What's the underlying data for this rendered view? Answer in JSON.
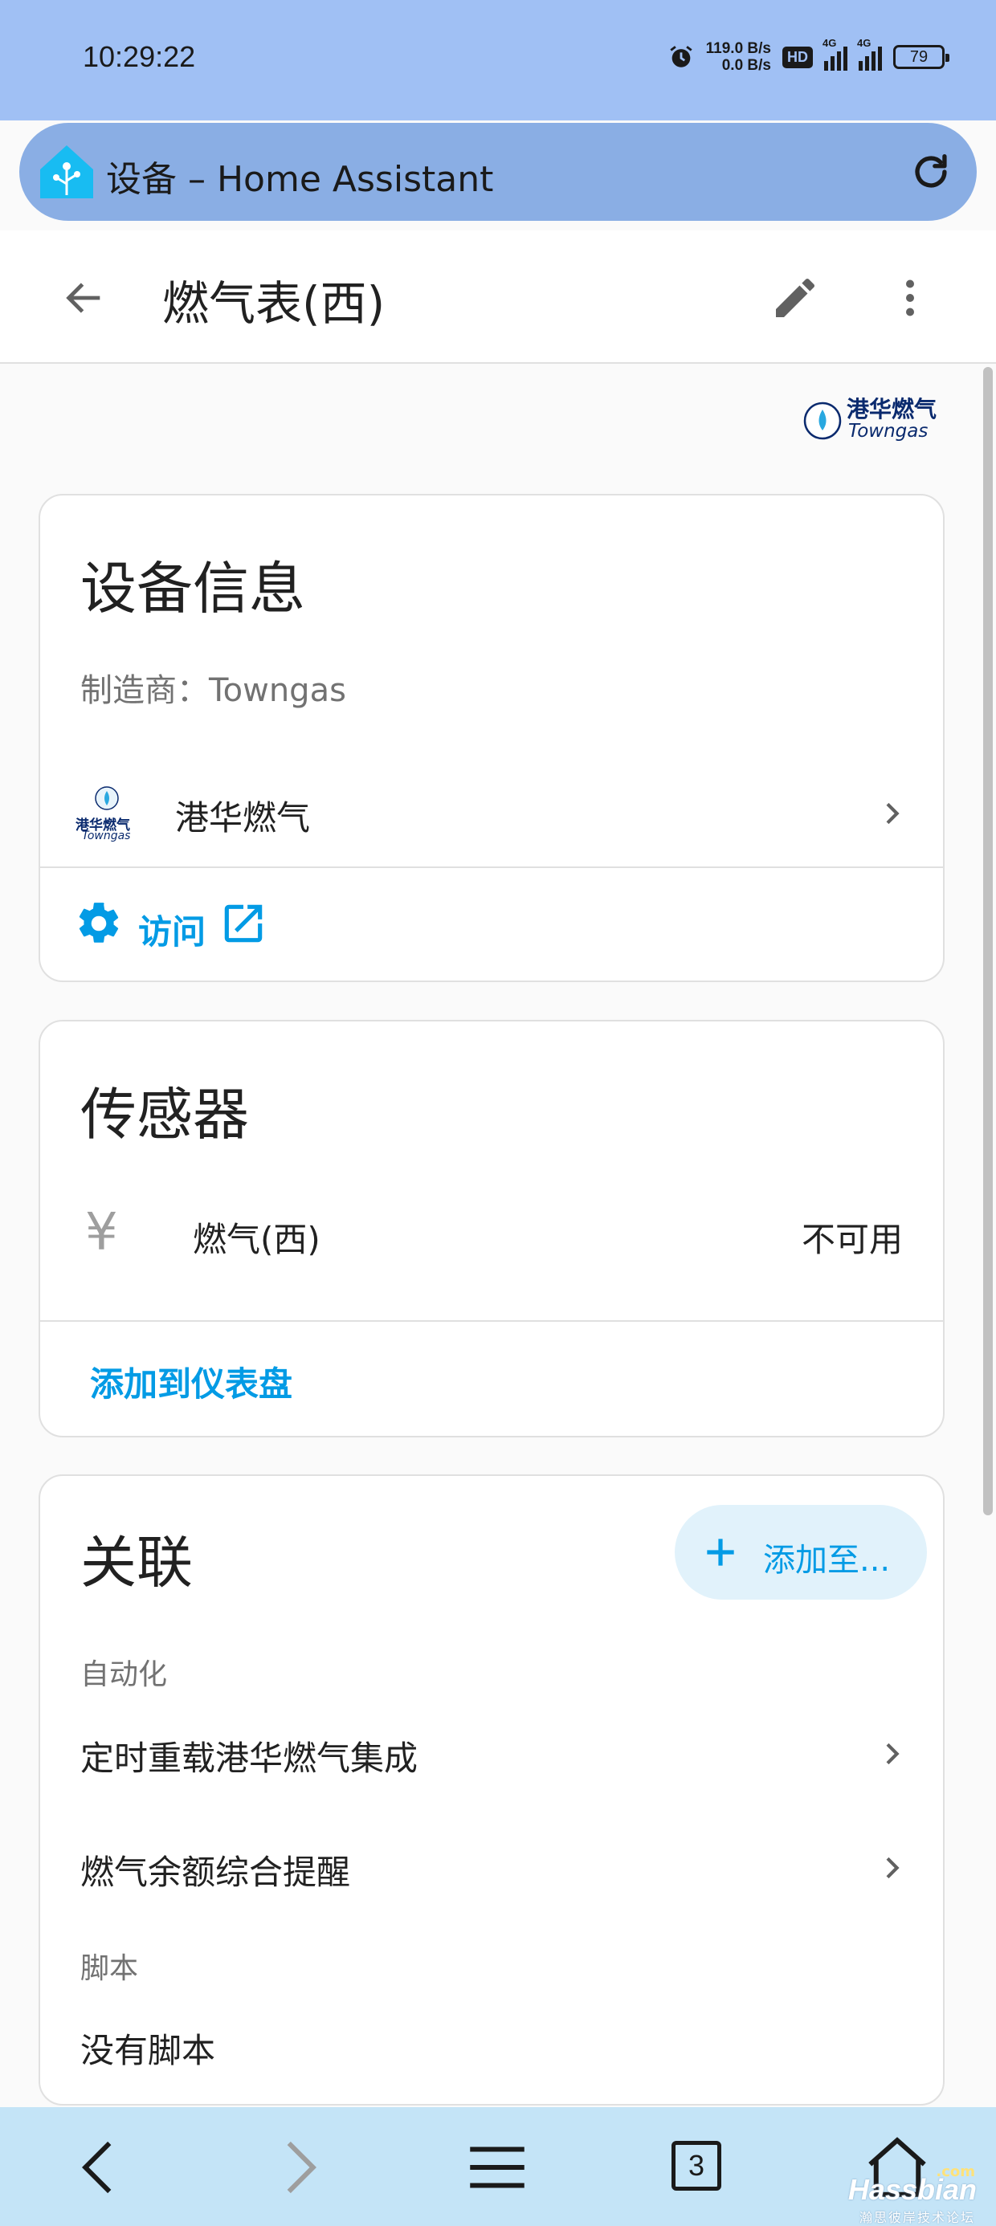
{
  "status_bar": {
    "time": "10:29:22",
    "net_up": "119.0 B/s",
    "net_down": "0.0 B/s",
    "hd_badge": "HD",
    "signal1_label": "4G",
    "signal2_label": "4G",
    "battery": "79"
  },
  "browser": {
    "title": "设备 – Home Assistant"
  },
  "toolbar": {
    "title": "燃气表(西)"
  },
  "brand": {
    "name": "港华燃气",
    "sub": "Towngas"
  },
  "device_info": {
    "title": "设备信息",
    "manufacturer": "制造商：Towngas",
    "integration_label": "港华燃气",
    "integration_logo_text": "港华燃气",
    "integration_logo_sub": "Towngas",
    "visit_label": "访问"
  },
  "sensors": {
    "title": "传感器",
    "icon_glyph": "¥",
    "items": [
      {
        "name": "燃气(西)",
        "state": "不可用"
      }
    ],
    "add_to_dashboard": "添加到仪表盘"
  },
  "related": {
    "title": "关联",
    "add_to_label": "添加至...",
    "automation_section": "自动化",
    "automations": [
      {
        "label": "定时重载港华燃气集成"
      },
      {
        "label": "燃气余额综合提醒"
      }
    ],
    "script_section": "脚本",
    "no_scripts": "没有脚本"
  },
  "bottom_nav": {
    "tab_count": "3",
    "watermark": "Hassbian",
    "watermark_com": ".com",
    "watermark_sub": "瀚思彼岸技术论坛"
  },
  "colors": {
    "accent": "#039be5",
    "status_bar": "#a0c0f4",
    "bottom_nav": "#c4e4f7"
  }
}
